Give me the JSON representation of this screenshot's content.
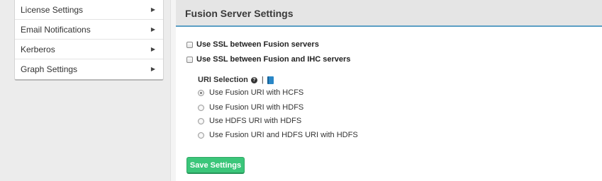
{
  "sidebar": {
    "items": [
      {
        "label": "License Settings",
        "arrow_icon": "triangle-right-icon"
      },
      {
        "label": "Email Notifications",
        "arrow_icon": "triangle-right-icon"
      },
      {
        "label": "Kerberos",
        "arrow_icon": "triangle-right-icon"
      },
      {
        "label": "Graph Settings",
        "arrow_icon": "triangle-right-icon"
      }
    ],
    "arrow_glyph": "▶"
  },
  "main": {
    "title": "Fusion Server Settings",
    "accent_color": "#5b9ec4",
    "checkboxes": [
      {
        "label": "Use SSL between Fusion servers",
        "checked": false
      },
      {
        "label": "Use SSL between Fusion and IHC servers",
        "checked": false
      }
    ],
    "uri_selection": {
      "title": "URI Selection",
      "help_icon": "question-circle-icon",
      "help_glyph": "?",
      "separator": "|",
      "doc_icon": "book-icon",
      "options": [
        {
          "label": "Use Fusion URI with HCFS",
          "selected": true
        },
        {
          "label": "Use Fusion URI with HDFS",
          "selected": false
        },
        {
          "label": "Use HDFS URI with HDFS",
          "selected": false
        },
        {
          "label": "Use Fusion URI and HDFS URI with HDFS",
          "selected": false
        }
      ]
    },
    "save_button": {
      "label": "Save Settings",
      "color": "#3bc67a"
    }
  }
}
